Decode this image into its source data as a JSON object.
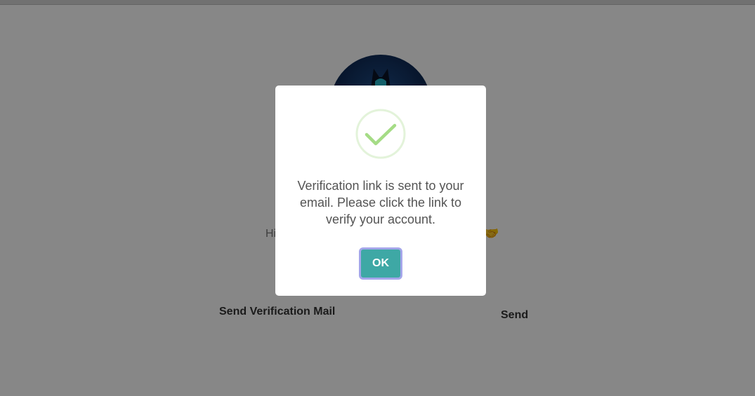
{
  "page": {
    "greeting_text": "Hi",
    "send_verification_label": "Send Verification Mail",
    "send_button_label": "Send",
    "emoji_icon": "handshake-emoji-icon"
  },
  "modal": {
    "icon": "success-checkmark-icon",
    "message": "Verification link is sent to your email. Please click the link to verify your account.",
    "ok_label": "OK"
  },
  "colors": {
    "overlay": "#000000",
    "success_green": "#a5dc86",
    "ok_button": "#3ea8a5",
    "ok_focus_ring": "#a4a6ea"
  }
}
